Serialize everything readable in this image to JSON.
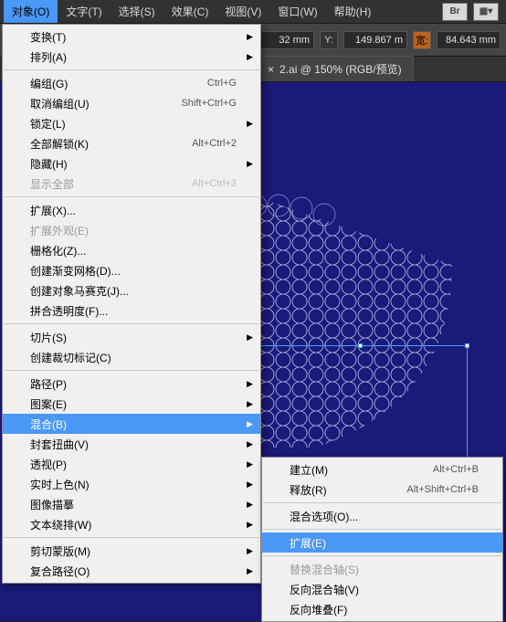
{
  "menubar": {
    "items": [
      "对象(O)",
      "文字(T)",
      "选择(S)",
      "效果(C)",
      "视图(V)",
      "窗口(W)",
      "帮助(H)"
    ],
    "br_label": "Br"
  },
  "toolbar": {
    "x_value": "32 mm",
    "y_label": "Y:",
    "y_value": "149.867 m",
    "w_label": "宽:",
    "w_value": "84.643 mm"
  },
  "tab": {
    "title": "2.ai @ 150% (RGB/预览)",
    "close": "×"
  },
  "object_menu": [
    {
      "l": "变换(T)",
      "s": "",
      "sub": true
    },
    {
      "l": "排列(A)",
      "s": "",
      "sub": true
    },
    {
      "sep": true
    },
    {
      "l": "编组(G)",
      "s": "Ctrl+G"
    },
    {
      "l": "取消编组(U)",
      "s": "Shift+Ctrl+G"
    },
    {
      "l": "锁定(L)",
      "s": "",
      "sub": true
    },
    {
      "l": "全部解锁(K)",
      "s": "Alt+Ctrl+2"
    },
    {
      "l": "隐藏(H)",
      "s": "",
      "sub": true
    },
    {
      "l": "显示全部",
      "s": "Alt+Ctrl+3",
      "dis": true
    },
    {
      "sep": true
    },
    {
      "l": "扩展(X)..."
    },
    {
      "l": "扩展外观(E)",
      "dis": true
    },
    {
      "l": "栅格化(Z)..."
    },
    {
      "l": "创建渐变网格(D)..."
    },
    {
      "l": "创建对象马赛克(J)..."
    },
    {
      "l": "拼合透明度(F)..."
    },
    {
      "sep": true
    },
    {
      "l": "切片(S)",
      "sub": true
    },
    {
      "l": "创建裁切标记(C)"
    },
    {
      "sep": true
    },
    {
      "l": "路径(P)",
      "sub": true
    },
    {
      "l": "图案(E)",
      "sub": true
    },
    {
      "l": "混合(B)",
      "sub": true,
      "hl": true
    },
    {
      "l": "封套扭曲(V)",
      "sub": true
    },
    {
      "l": "透视(P)",
      "sub": true
    },
    {
      "l": "实时上色(N)",
      "sub": true
    },
    {
      "l": "图像描摹",
      "sub": true
    },
    {
      "l": "文本绕排(W)",
      "sub": true
    },
    {
      "sep": true
    },
    {
      "l": "剪切蒙版(M)",
      "sub": true
    },
    {
      "l": "复合路径(O)",
      "sub": true
    }
  ],
  "blend_menu": [
    {
      "l": "建立(M)",
      "s": "Alt+Ctrl+B"
    },
    {
      "l": "释放(R)",
      "s": "Alt+Shift+Ctrl+B"
    },
    {
      "sep": true
    },
    {
      "l": "混合选项(O)..."
    },
    {
      "sep": true
    },
    {
      "l": "扩展(E)",
      "hl": true
    },
    {
      "sep": true
    },
    {
      "l": "替换混合轴(S)",
      "dis": true
    },
    {
      "l": "反向混合轴(V)"
    },
    {
      "l": "反向堆叠(F)"
    }
  ]
}
